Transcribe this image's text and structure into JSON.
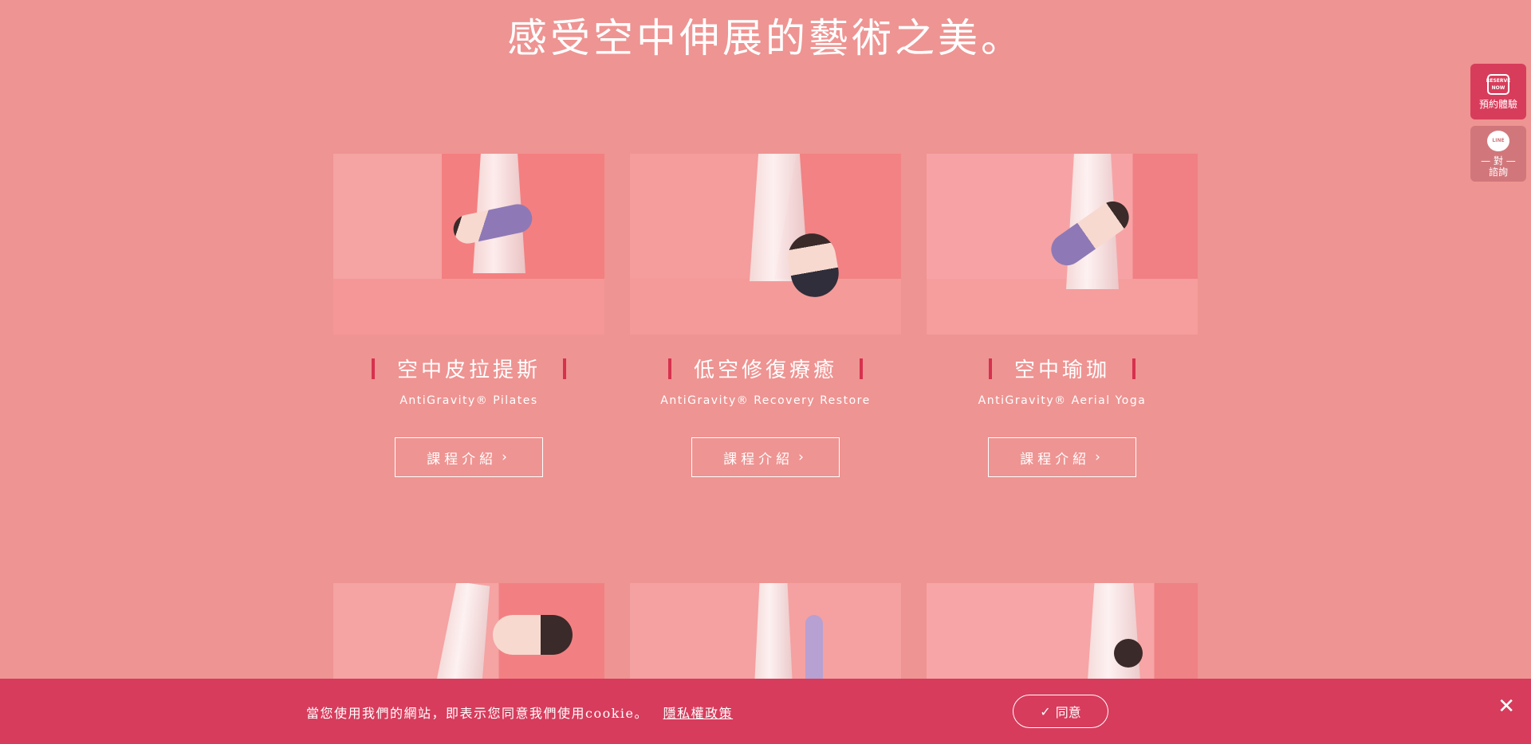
{
  "headline": "感受空中伸展的藝術之美。",
  "courses": [
    {
      "title": "空中皮拉提斯",
      "subtitle": "AntiGravity® Pilates",
      "button": "課程介紹"
    },
    {
      "title": "低空修復療癒",
      "subtitle": "AntiGravity® Recovery Restore",
      "button": "課程介紹"
    },
    {
      "title": "空中瑜珈",
      "subtitle": "AntiGravity® Aerial Yoga",
      "button": "課程介紹"
    }
  ],
  "side": {
    "reserve_icon_text": "RESERVE NOW",
    "reserve_label": "預約體驗",
    "line_icon_text": "LINE",
    "line_label_1": "— 對 —",
    "line_label_2": "諮詢"
  },
  "cookie": {
    "message": "當您使用我們的網站，即表示您同意我們使用cookie。",
    "privacy_link": "隱私權政策",
    "agree": "同意",
    "close": "✕"
  }
}
